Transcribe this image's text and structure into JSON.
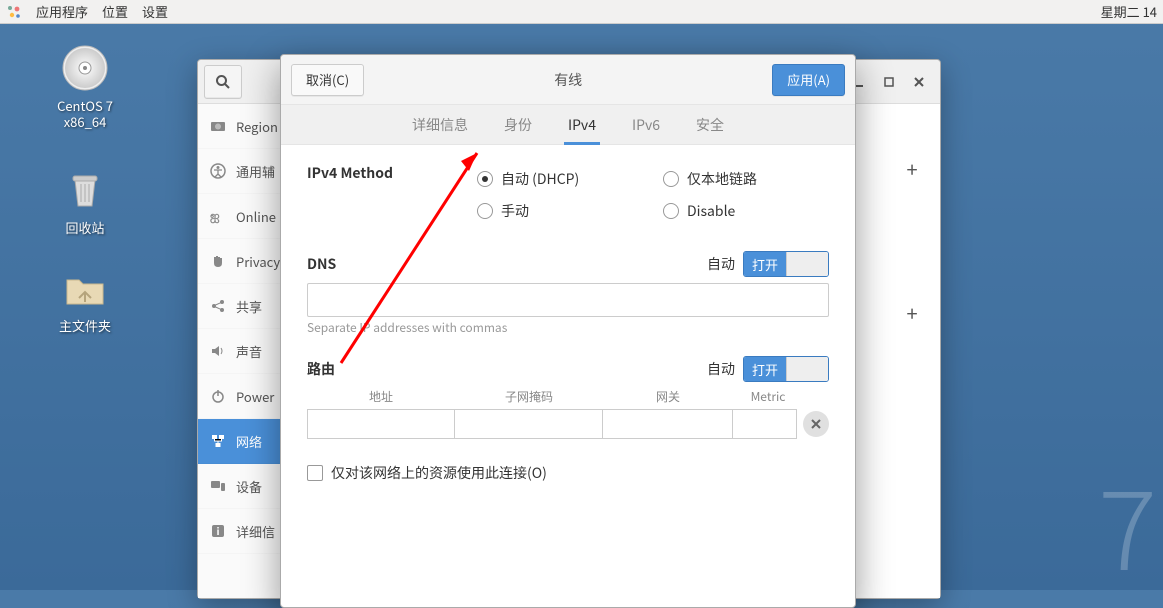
{
  "topbar": {
    "apps": "应用程序",
    "places": "位置",
    "settings": "设置",
    "clock": "星期二  14"
  },
  "desktop": {
    "cd_label_1": "CentOS 7",
    "cd_label_2": "x86_64",
    "trash": "回收站",
    "home": "主文件夹"
  },
  "sidebar": {
    "items": [
      {
        "icon": "camera",
        "label": "Region"
      },
      {
        "icon": "universal",
        "label": "通用辅"
      },
      {
        "icon": "cloud",
        "label": "Online"
      },
      {
        "icon": "hand",
        "label": "Privacy"
      },
      {
        "icon": "share",
        "label": "共享"
      },
      {
        "icon": "sound",
        "label": "声音"
      },
      {
        "icon": "power",
        "label": "Power"
      },
      {
        "icon": "network",
        "label": "网络"
      },
      {
        "icon": "devices",
        "label": "设备"
      },
      {
        "icon": "info",
        "label": "详细信"
      }
    ]
  },
  "dialog": {
    "cancel": "取消(C)",
    "title": "有线",
    "apply": "应用(A)",
    "tabs": {
      "details": "详细信息",
      "identity": "身份",
      "ipv4": "IPv4",
      "ipv6": "IPv6",
      "security": "安全"
    },
    "ipv4": {
      "method_label": "IPv4 Method",
      "opt_auto": "自动 (DHCP)",
      "opt_local": "仅本地链路",
      "opt_manual": "手动",
      "opt_disable": "Disable",
      "dns_label": "DNS",
      "auto_label": "自动",
      "switch_on": "打开",
      "dns_hint": "Separate IP addresses with commas",
      "routes_label": "路由",
      "route_addr": "地址",
      "route_mask": "子网掩码",
      "route_gw": "网关",
      "route_metric": "Metric",
      "only_this_net": "仅对该网络上的资源使用此连接(O)"
    }
  }
}
